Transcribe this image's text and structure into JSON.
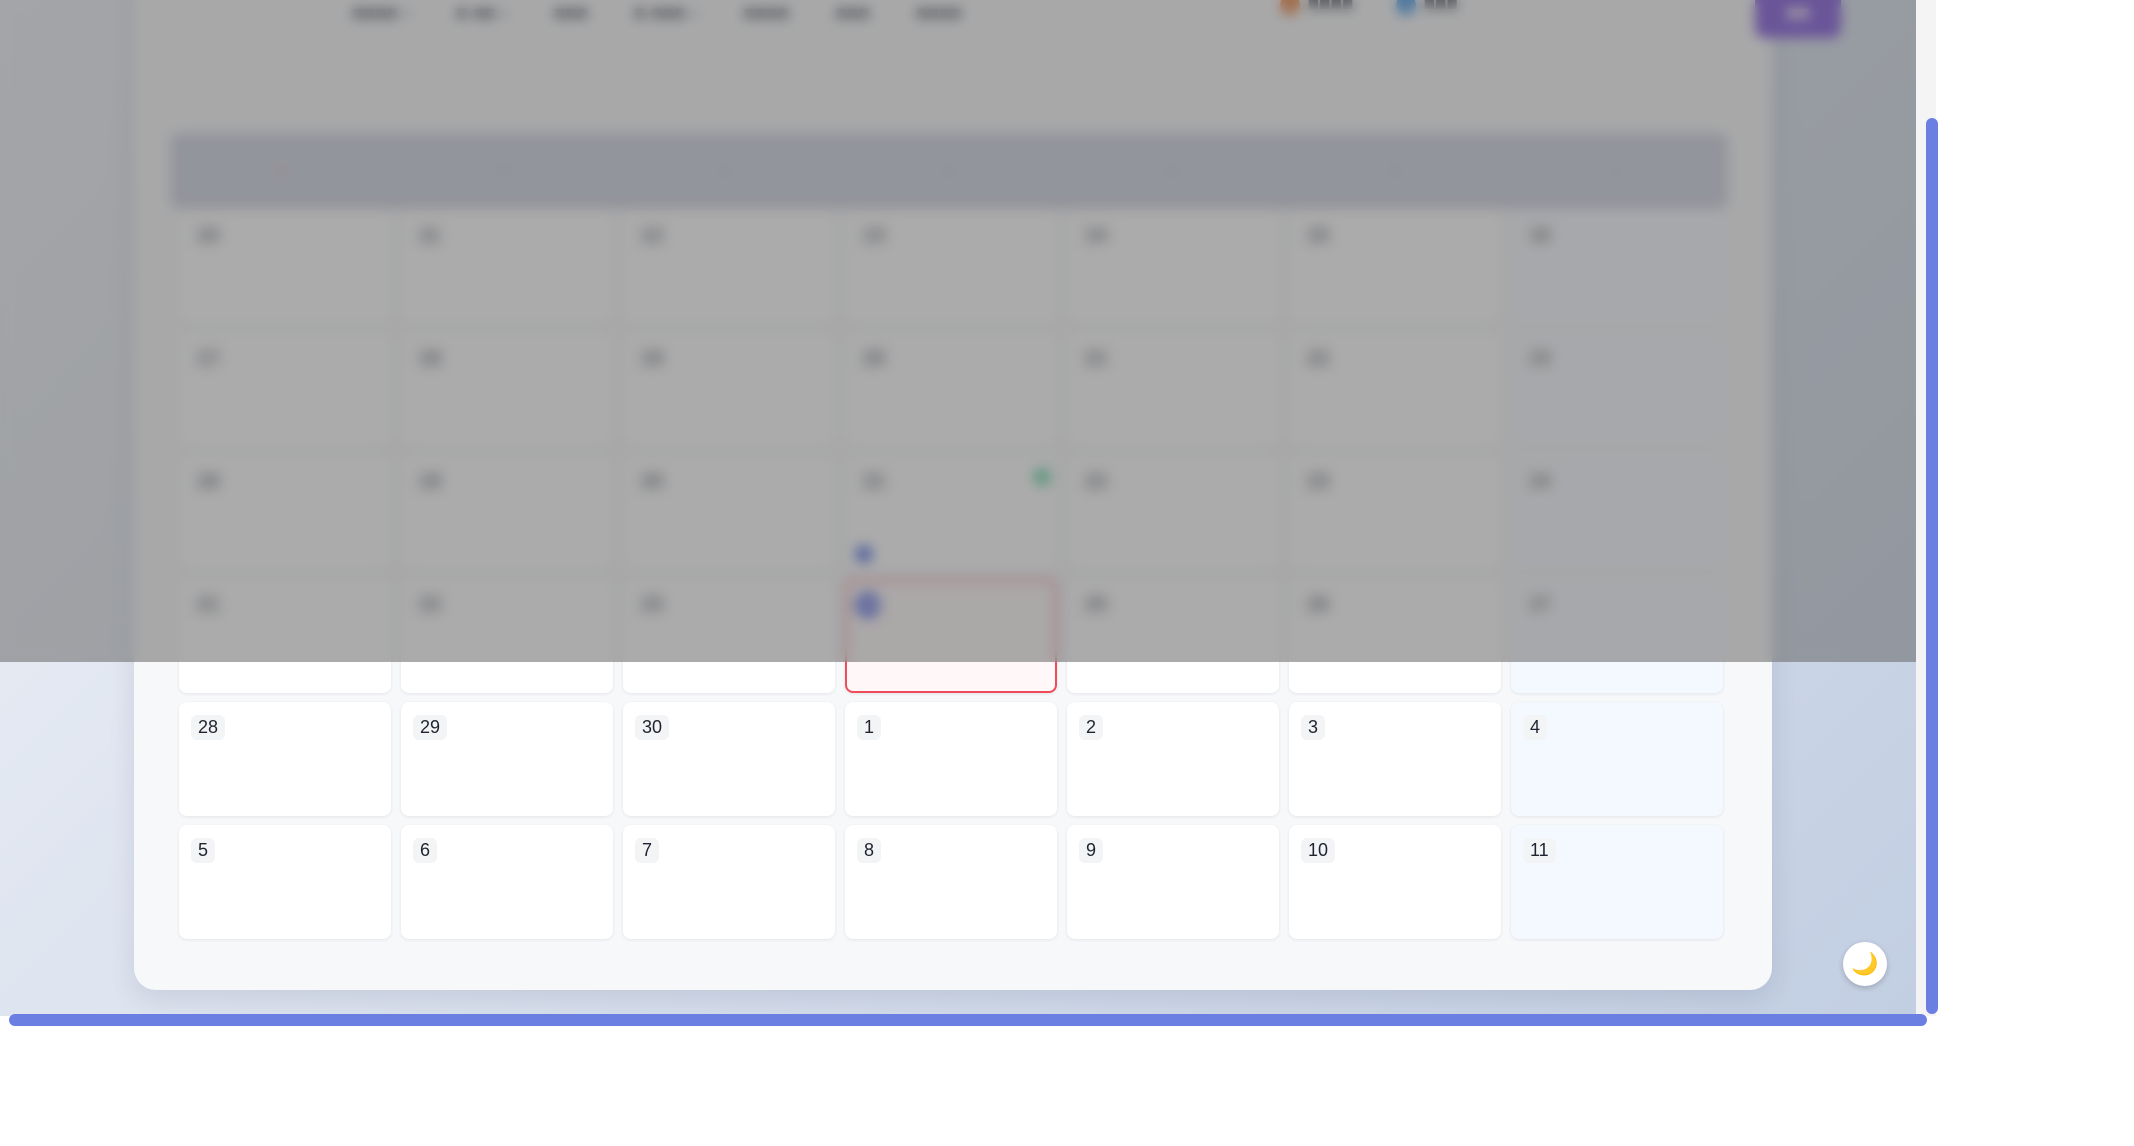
{
  "toolbar": {
    "items": [
      {
        "label": "■■■■",
        "has_caret": true
      },
      {
        "label": "■ ■■",
        "has_caret": true
      },
      {
        "label": "■■■",
        "has_caret": false
      },
      {
        "label": "■ ■■■",
        "has_caret": true
      },
      {
        "label": "■■■■",
        "has_caret": false
      },
      {
        "label": "■■■",
        "has_caret": false
      },
      {
        "label": "■■■■",
        "has_caret": false
      }
    ],
    "caret_glyph": "▾"
  },
  "legend": [
    {
      "label": "■■■■",
      "color": "#e8742a"
    },
    {
      "label": "■■■",
      "color": "#2f8de4"
    }
  ],
  "primary_button": {
    "label": "■■"
  },
  "weekday_colors": [
    "#f0a0a0",
    "#a8b4ea",
    "#a8b4ea",
    "#a8b4ea",
    "#a8b4ea",
    "#a8b4ea",
    "#96d8c4"
  ],
  "calendar": {
    "weeks": [
      [
        {
          "day": "10"
        },
        {
          "day": "11"
        },
        {
          "day": "12"
        },
        {
          "day": "13"
        },
        {
          "day": "14"
        },
        {
          "day": "15"
        },
        {
          "day": "16"
        }
      ],
      [
        {
          "day": "17"
        },
        {
          "day": "18"
        },
        {
          "day": "19"
        },
        {
          "day": "20"
        },
        {
          "day": "21"
        },
        {
          "day": "22"
        },
        {
          "day": "23"
        }
      ],
      [
        {
          "day": "18"
        },
        {
          "day": "19"
        },
        {
          "day": "20"
        },
        {
          "day": "21"
        },
        {
          "day": "22"
        },
        {
          "day": "23"
        },
        {
          "day": "24"
        }
      ],
      [
        {
          "day": "21"
        },
        {
          "day": "22"
        },
        {
          "day": "23"
        },
        {
          "day": "24",
          "today": true
        },
        {
          "day": "25"
        },
        {
          "day": "26"
        },
        {
          "day": "27"
        }
      ],
      [
        {
          "day": "28"
        },
        {
          "day": "29"
        },
        {
          "day": "30"
        },
        {
          "day": "1"
        },
        {
          "day": "2"
        },
        {
          "day": "3"
        },
        {
          "day": "4"
        }
      ],
      [
        {
          "day": "5"
        },
        {
          "day": "6"
        },
        {
          "day": "7"
        },
        {
          "day": "8"
        },
        {
          "day": "9"
        },
        {
          "day": "10"
        },
        {
          "day": "11"
        }
      ]
    ]
  },
  "event_dot_colors": {
    "green": "#5dd4a2",
    "blue": "#4c6ae6"
  },
  "theme_toggle": {
    "icon": "🌙",
    "icon_name": "moon-icon"
  },
  "colors": {
    "accent": "#6b7fe3",
    "primary_button": "#6d3cd6",
    "today_border": "#ef4b5a",
    "today_badge": "#3f56e0"
  }
}
